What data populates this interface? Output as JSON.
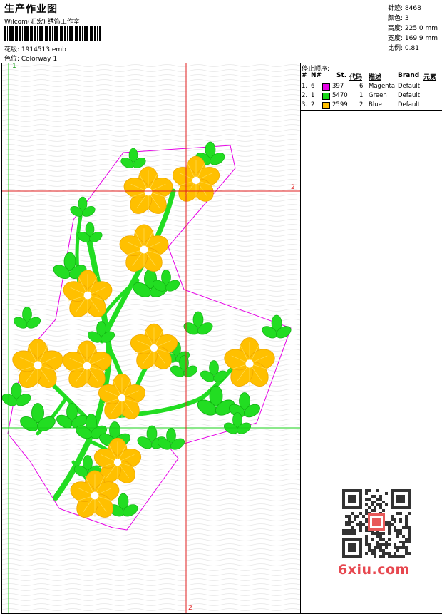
{
  "header": {
    "title": "生产作业图",
    "company": "Wilcom(汇宏) 绣饰工作室",
    "file": "花版: 1914513.emb",
    "colorway": "色位: Colorway 1"
  },
  "stats": {
    "stitches": "针迹: 8468",
    "colors": "颜色: 3",
    "height": "高度: 225.0 mm",
    "width": "宽度: 169.9 mm",
    "scale": "比例: 0.81"
  },
  "canvas": {
    "marker_1": "1",
    "marker_2_right": "2",
    "marker_2_bottom": "2"
  },
  "stop_sequence": {
    "title": "停止顺序:",
    "headers": [
      "#",
      "N#",
      "St.",
      "代码",
      "描述",
      "Brand",
      "元素"
    ],
    "rows": [
      {
        "idx": "1.",
        "n": "6",
        "stitches": "397",
        "code": "6",
        "desc": "Magenta",
        "brand": "Default",
        "color": "#e600e6"
      },
      {
        "idx": "2.",
        "n": "1",
        "stitches": "5470",
        "code": "1",
        "desc": "Green",
        "brand": "Default",
        "color": "#17d917"
      },
      {
        "idx": "3.",
        "n": "2",
        "stitches": "2599",
        "code": "2",
        "desc": "Blue",
        "brand": "Default",
        "color": "#ffbf00"
      }
    ]
  },
  "watermark": {
    "text": "6xiu.com"
  }
}
